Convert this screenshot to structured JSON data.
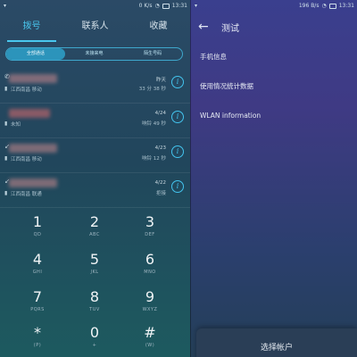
{
  "left": {
    "status": {
      "left": "",
      "right": "0 K/s",
      "time": "13:31"
    },
    "tabs": [
      {
        "label": "拨号",
        "active": true
      },
      {
        "label": "联系人",
        "active": false
      },
      {
        "label": "收藏",
        "active": false
      }
    ],
    "filters": [
      {
        "label": "全部通话",
        "active": true
      },
      {
        "label": "未接来电",
        "active": false
      },
      {
        "label": "陌生号码",
        "active": false
      }
    ],
    "calls": [
      {
        "location": "江西南昌 移动",
        "date": "昨天",
        "meta": "33 分 38 秒"
      },
      {
        "location": "未知",
        "date": "4/24",
        "meta": "响铃 49 秒"
      },
      {
        "location": "江西南昌 移动",
        "date": "4/23",
        "meta": "响铃 12 秒"
      },
      {
        "location": "江西南昌 联通",
        "date": "4/22",
        "meta": "拒接"
      }
    ],
    "keypad": [
      {
        "digit": "1",
        "letters": "QD"
      },
      {
        "digit": "2",
        "letters": "ABC"
      },
      {
        "digit": "3",
        "letters": "DEF"
      },
      {
        "digit": "4",
        "letters": "GHI"
      },
      {
        "digit": "5",
        "letters": "JKL"
      },
      {
        "digit": "6",
        "letters": "MNO"
      },
      {
        "digit": "7",
        "letters": "PQRS"
      },
      {
        "digit": "8",
        "letters": "TUV"
      },
      {
        "digit": "9",
        "letters": "WXYZ"
      },
      {
        "digit": "*",
        "letters": "(P)"
      },
      {
        "digit": "0",
        "letters": "+"
      },
      {
        "digit": "#",
        "letters": "(W)"
      }
    ]
  },
  "right": {
    "status": {
      "right": "196 B/s",
      "time": "13:31"
    },
    "title": "测试",
    "menu": [
      "手机信息",
      "使用情况统计数据",
      "WLAN information"
    ],
    "sheet_label": "选择帐户"
  },
  "colors": {
    "accent": "#49c7ee",
    "leftBg": "#21465c",
    "rightBg": "#3f3a84"
  },
  "icons": {
    "back": "arrow-left-icon",
    "info": "info-icon",
    "sim": "sim-card-icon",
    "call": "phone-icon"
  }
}
